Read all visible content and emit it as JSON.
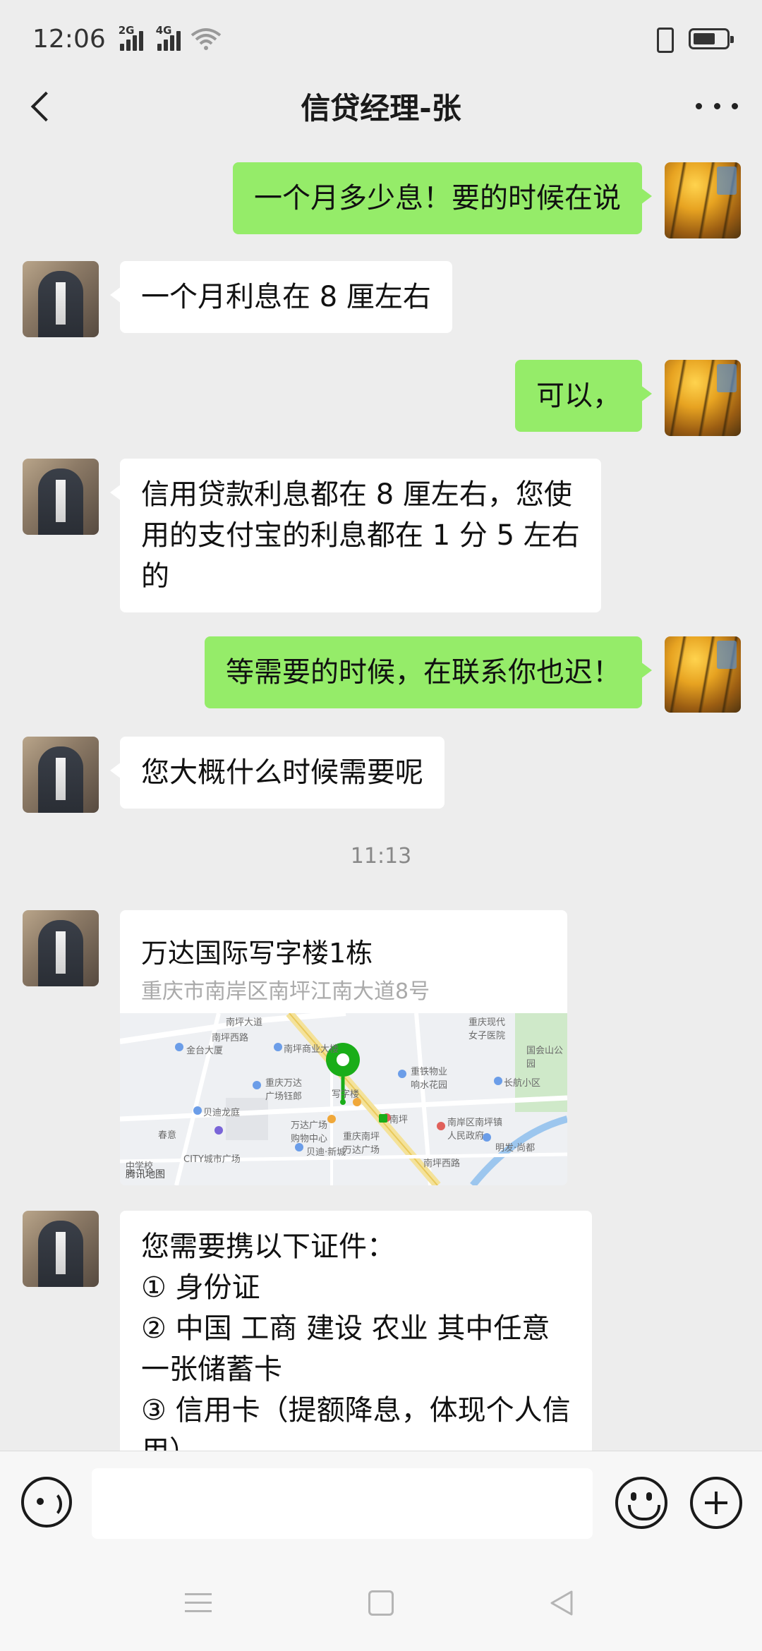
{
  "status_bar": {
    "time": "12:06",
    "signal1_label": "2G",
    "signal2_label": "4G",
    "icons": [
      "signal-2g-icon",
      "signal-4g-icon",
      "wifi-icon",
      "vibrate-icon",
      "battery-icon"
    ]
  },
  "chat": {
    "title": "信贷经理-张",
    "back_icon": "chevron-left-icon",
    "more_icon": "more-dots-icon"
  },
  "messages": [
    {
      "from": "me",
      "lines": [
        "一个月多少息！要的时候在说"
      ]
    },
    {
      "from": "them",
      "lines": [
        "一个月利息在 8 厘左右"
      ]
    },
    {
      "from": "me",
      "lines": [
        "可以，"
      ]
    },
    {
      "from": "them",
      "lines": [
        "信用贷款利息都在 8 厘左右，您使",
        "用的支付宝的利息都在 1 分 5 左右",
        "的"
      ]
    },
    {
      "from": "me",
      "lines": [
        "等需要的时候，在联系你也迟！"
      ]
    },
    {
      "from": "them",
      "lines": [
        "您大概什么时候需要呢"
      ]
    },
    {
      "from": "them",
      "lines": [
        "您需要携以下证件：",
        "① 身份证",
        "② 中国 工商 建设  农业 其中任意",
        "一张储蓄卡",
        "③ 信用卡（提额降息，体现个人信",
        "用）"
      ]
    }
  ],
  "timestamp": "11:13",
  "location": {
    "name": "万达国际写字楼1栋",
    "address": "重庆市南岸区南坪江南大道8号",
    "map_credit": "腾讯地图",
    "map_labels": {
      "l1": "南坪大道",
      "l2": "南坪西路",
      "l3": "重庆现代女子医院",
      "l4": "金台大厦",
      "l5": "南坪商业大楼",
      "l6": "国会山公园",
      "l7": "重铁物业响水花园",
      "l8": "重庆万达广场钰郎",
      "l9": "写字楼",
      "l10": "长航小区",
      "l11": "贝迪龙庭",
      "l12": "南坪",
      "l13": "南岸区南坪镇人民政府",
      "l14": "春意",
      "l15": "万达广场购物中心",
      "l16": "重庆南坪万达广场",
      "l17": "明发·尚都",
      "l18": "CITY城市广场",
      "l19": "贝迪·新城",
      "l20": "中学校",
      "l21": "南坪西路"
    }
  },
  "input_bar": {
    "voice_icon": "voice-icon",
    "emoji_icon": "emoji-icon",
    "plus_icon": "plus-icon",
    "input_value": ""
  },
  "nav_bar": {
    "icons": [
      "menu-icon",
      "home-icon",
      "back-triangle-icon"
    ]
  },
  "colors": {
    "background": "#ededed",
    "my_bubble": "#95ec69",
    "their_bubble": "#ffffff",
    "map_pin": "#1aad19"
  }
}
